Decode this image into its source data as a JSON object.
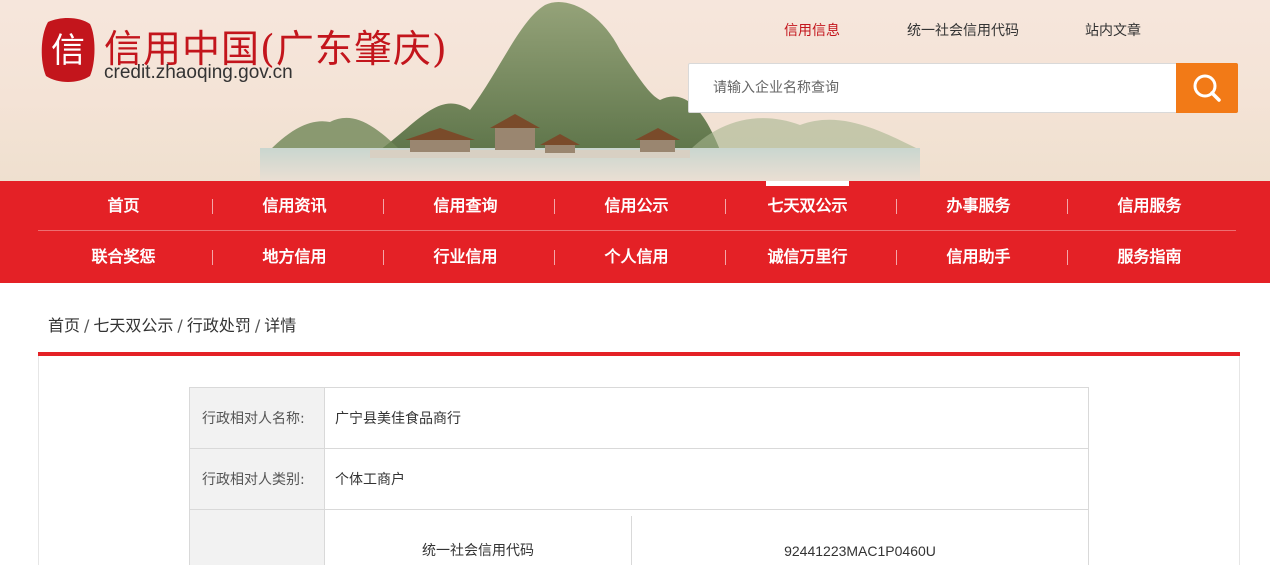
{
  "header": {
    "site_title": "信用中国(广东肇庆)",
    "site_domain": "credit.zhaoqing.gov.cn",
    "logo_text": "信",
    "top_links": [
      {
        "label": "信用信息",
        "active": true
      },
      {
        "label": "统一社会信用代码",
        "active": false
      },
      {
        "label": "站内文章",
        "active": false
      }
    ],
    "search": {
      "placeholder": "请输入企业名称查询",
      "value": "",
      "icon": "search-icon"
    }
  },
  "nav": {
    "row1": [
      "首页",
      "信用资讯",
      "信用查询",
      "信用公示",
      "七天双公示",
      "办事服务",
      "信用服务"
    ],
    "row2": [
      "联合奖惩",
      "地方信用",
      "行业信用",
      "个人信用",
      "诚信万里行",
      "信用助手",
      "服务指南"
    ],
    "active": "七天双公示"
  },
  "breadcrumb": {
    "items": [
      "首页",
      "七天双公示",
      "行政处罚",
      "详情"
    ],
    "separator": "/"
  },
  "detail": {
    "rows": [
      {
        "label": "行政相对人名称:",
        "value": "广宁县美佳食品商行"
      },
      {
        "label": "行政相对人类别:",
        "value": "个体工商户"
      }
    ],
    "code_row": {
      "sub_label": "统一社会信用代码",
      "sub_value": "92441223MAC1P0460U"
    }
  },
  "colors": {
    "brand_red": "#e42126",
    "title_red": "#c3151c",
    "search_orange": "#f27a17"
  }
}
